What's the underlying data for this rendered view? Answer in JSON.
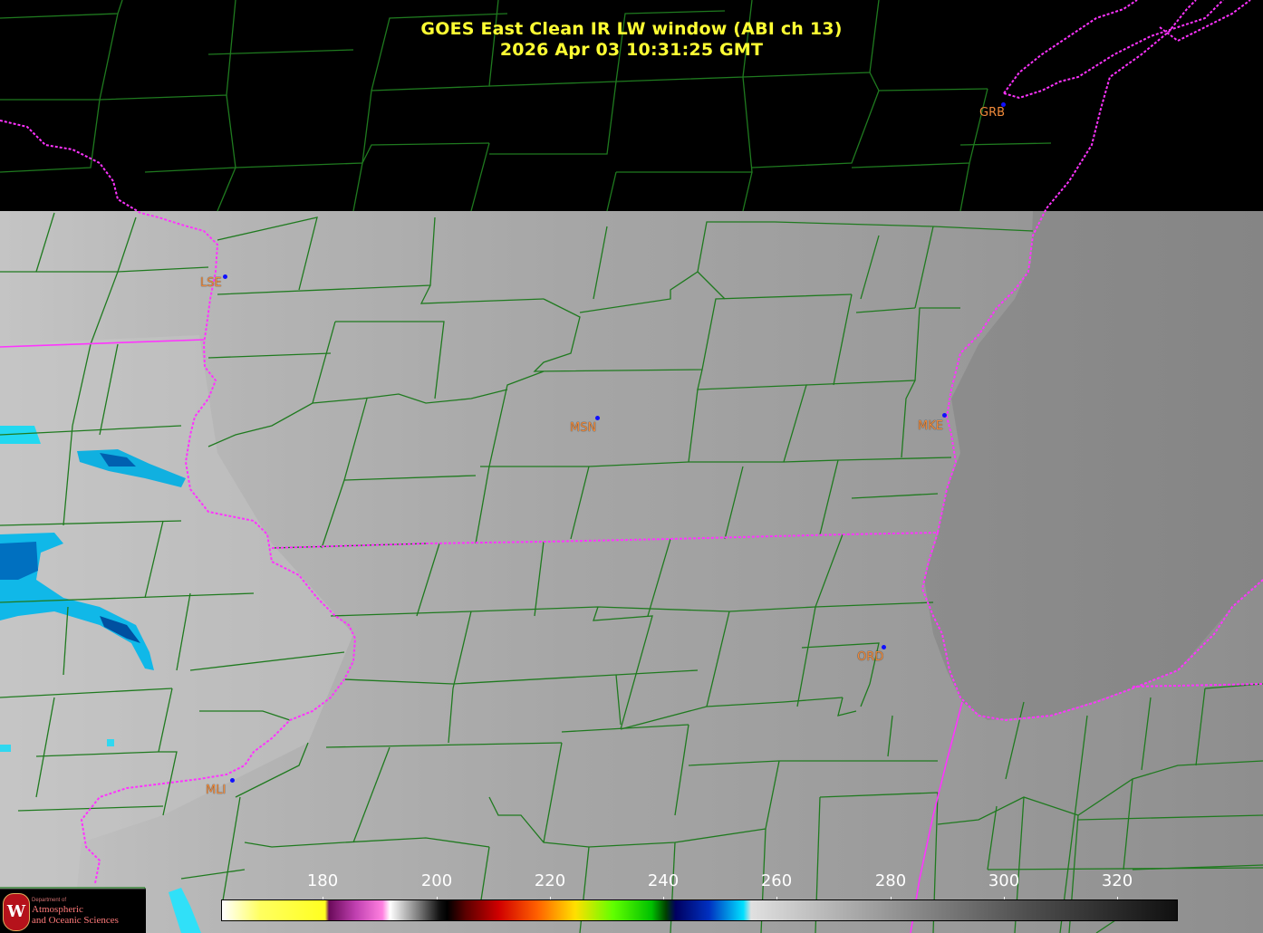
{
  "title": {
    "line1": "GOES East Clean IR LW window (ABI ch 13)",
    "line2": "2026 Apr 03  10:31:25 GMT",
    "color": "#ffff33"
  },
  "stations": [
    {
      "id": "LSE"
    },
    {
      "id": "MSN"
    },
    {
      "id": "MKE"
    },
    {
      "id": "ORD"
    },
    {
      "id": "MLI"
    },
    {
      "id": "GRB"
    }
  ],
  "colorbar": {
    "ticks": [
      "180",
      "200",
      "220",
      "240",
      "260",
      "280",
      "300",
      "320"
    ]
  },
  "logo": {
    "seal_letter": "W",
    "dept": "Department of",
    "name_line1": "Atmospheric",
    "name_line2": "and Oceanic Sciences"
  },
  "colors": {
    "county_lines": "#1f7a1f",
    "state_borders": "#ff33ff",
    "background_no_data": "#000000",
    "cloud_cold": "#00e0ff"
  }
}
